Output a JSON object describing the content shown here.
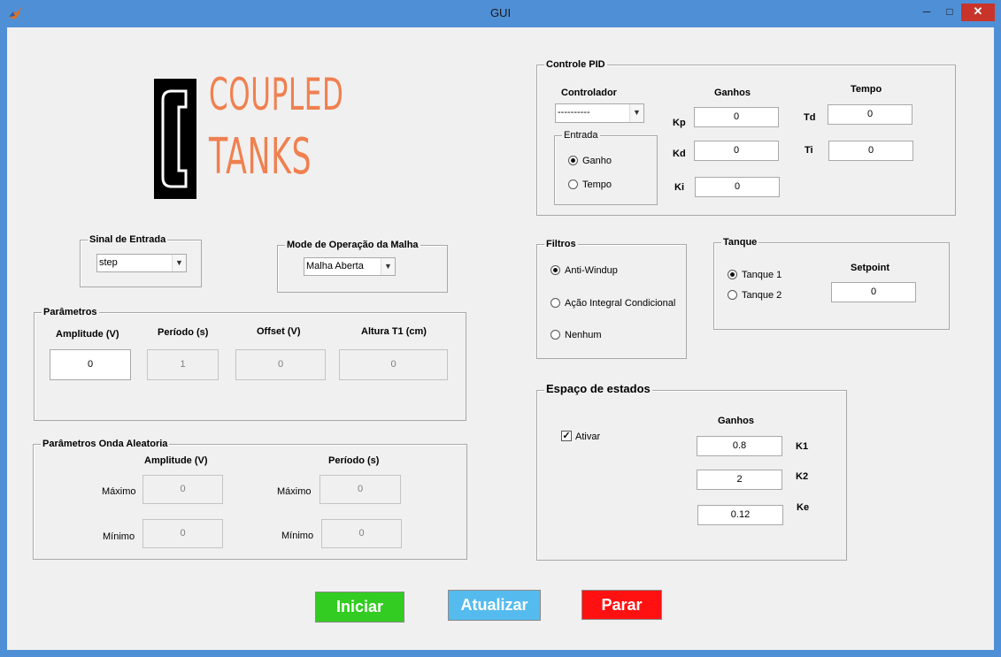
{
  "window": {
    "title": "GUI",
    "app_icon": "matlab-icon",
    "controls": {
      "minimize": "─",
      "maximize": "□",
      "close": "✕"
    }
  },
  "logo": {
    "letter": "C",
    "line1": "COUPLED",
    "line2": "TANKS",
    "accent_color": "#f08050"
  },
  "sinal_entrada": {
    "title": "Sinal de Entrada",
    "selected": "step"
  },
  "modo_operacao": {
    "title": "Mode de Operação da Malha",
    "selected": "Malha Aberta"
  },
  "parametros": {
    "title": "Parâmetros",
    "amplitude_label": "Amplitude (V)",
    "amplitude_value": "0",
    "periodo_label": "Período (s)",
    "periodo_value": "1",
    "offset_label": "Offset (V)",
    "offset_value": "0",
    "altura_label": "Altura T1 (cm)",
    "altura_value": "0"
  },
  "onda_aleatoria": {
    "title": "Parâmetros Onda Aleatoria",
    "amplitude_header": "Amplitude (V)",
    "periodo_header": "Período (s)",
    "maximo_label": "Máximo",
    "minimo_label": "Mínimo",
    "amp_max": "0",
    "amp_min": "0",
    "per_max": "0",
    "per_min": "0"
  },
  "pid": {
    "title": "Controle PID",
    "controlador_label": "Controlador",
    "controlador_selected": "----------",
    "entrada_title": "Entrada",
    "entrada_ganho": "Ganho",
    "entrada_tempo": "Tempo",
    "ganhos_label": "Ganhos",
    "tempo_label": "Tempo",
    "kp_label": "Kp",
    "kp_value": "0",
    "kd_label": "Kd",
    "kd_value": "0",
    "ki_label": "Ki",
    "ki_value": "0",
    "td_label": "Td",
    "td_value": "0",
    "ti_label": "Ti",
    "ti_value": "0"
  },
  "filtros": {
    "title": "Filtros",
    "options": [
      "Anti-Windup",
      "Ação Integral Condicional",
      "Nenhum"
    ],
    "selected": "Anti-Windup"
  },
  "tanque": {
    "title": "Tanque",
    "options": [
      "Tanque 1",
      "Tanque 2"
    ],
    "selected": "Tanque 1",
    "setpoint_label": "Setpoint",
    "setpoint_value": "0"
  },
  "espaco_estados": {
    "title": "Espaço de estados",
    "ativar_label": "Ativar",
    "ativar_checked": true,
    "ganhos_label": "Ganhos",
    "k1_label": "K1",
    "k1_value": "0.8",
    "k2_label": "K2",
    "k2_value": "2",
    "ke_label": "Ke",
    "ke_value": "0.12"
  },
  "buttons": {
    "iniciar": "Iniciar",
    "iniciar_color": "#33cc22",
    "atualizar": "Atualizar",
    "atualizar_color": "#55bbee",
    "parar": "Parar",
    "parar_color": "#ff1111"
  }
}
